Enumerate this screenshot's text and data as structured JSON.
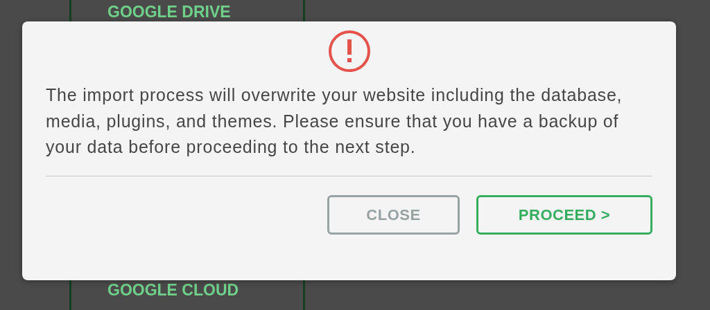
{
  "background": {
    "items": [
      "GOOGLE DRIVE",
      "GOOGLE CLOUD"
    ]
  },
  "dialog": {
    "message": "The import process will overwrite your website including the database, media, plugins, and themes. Please ensure that you have a backup of your data before proceeding to the next step.",
    "buttons": [
      {
        "label": "CLOSE",
        "kind": "secondary"
      },
      {
        "label": "PROCEED >",
        "kind": "primary"
      }
    ]
  }
}
